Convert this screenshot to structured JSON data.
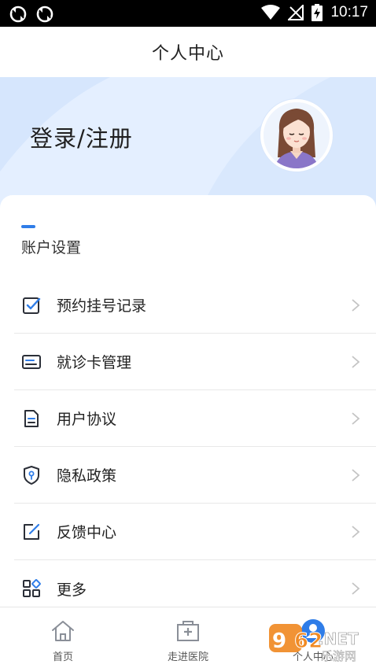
{
  "status_bar": {
    "time": "10:17"
  },
  "header": {
    "title": "个人中心"
  },
  "banner": {
    "login_text": "登录/注册"
  },
  "section": {
    "title": "账户设置"
  },
  "menu": [
    {
      "label": "预约挂号记录",
      "icon": "checklist-icon"
    },
    {
      "label": "就诊卡管理",
      "icon": "card-icon"
    },
    {
      "label": "用户协议",
      "icon": "document-icon"
    },
    {
      "label": "隐私政策",
      "icon": "shield-icon"
    },
    {
      "label": "反馈中心",
      "icon": "edit-icon"
    },
    {
      "label": "更多",
      "icon": "grid-icon"
    }
  ],
  "bottom_nav": [
    {
      "label": "首页",
      "icon": "home-icon"
    },
    {
      "label": "走进医院",
      "icon": "hospital-icon"
    },
    {
      "label": "个人中心",
      "icon": "person-icon"
    }
  ],
  "watermark": {
    "text": "962.NET",
    "subtext": "乐游网"
  },
  "colors": {
    "accent": "#2f7de8",
    "banner_bg": "#e4efff",
    "text_primary": "#222222",
    "arrow": "#c4c4c4"
  }
}
